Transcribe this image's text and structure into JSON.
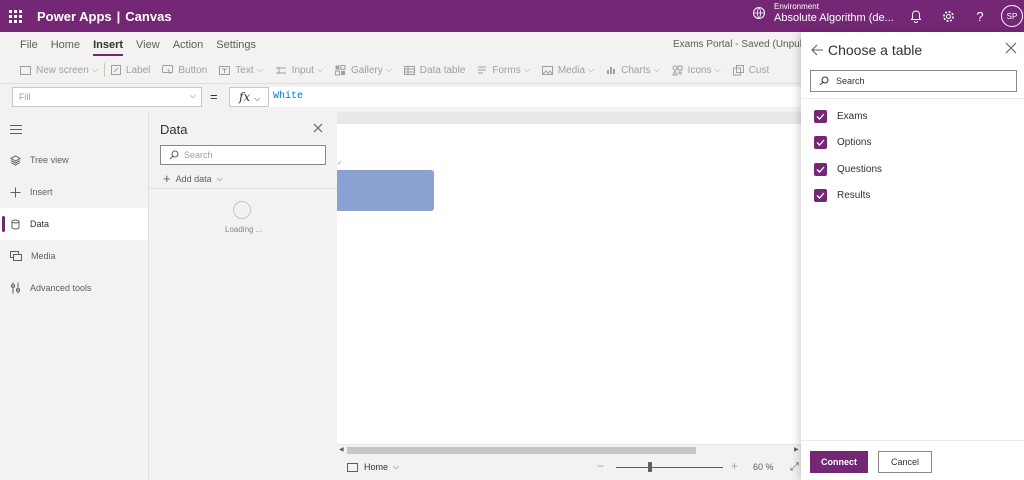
{
  "topbar": {
    "product": "Power Apps",
    "separator": "|",
    "mode": "Canvas",
    "env_label": "Environment",
    "env_name": "Absolute Algorithm (de...",
    "avatar_initials": "SP",
    "help_glyph": "?",
    "brand_color": "#742774"
  },
  "menu": {
    "items": [
      "File",
      "Home",
      "Insert",
      "View",
      "Action",
      "Settings"
    ],
    "active": "Insert",
    "saved_status": "Exams Portal - Saved (Unpublis"
  },
  "toolbar": {
    "items": [
      {
        "label": "New screen",
        "icon": "new-screen-icon"
      },
      {
        "label": "Label",
        "icon": "label-icon"
      },
      {
        "label": "Button",
        "icon": "button-icon"
      },
      {
        "label": "Text",
        "icon": "text-icon"
      },
      {
        "label": "Input",
        "icon": "input-icon"
      },
      {
        "label": "Gallery",
        "icon": "gallery-icon"
      },
      {
        "label": "Data table",
        "icon": "data-table-icon"
      },
      {
        "label": "Forms",
        "icon": "forms-icon"
      },
      {
        "label": "Media",
        "icon": "media-icon"
      },
      {
        "label": "Charts",
        "icon": "charts-icon"
      },
      {
        "label": "Icons",
        "icon": "icons-icon"
      },
      {
        "label": "Cust",
        "icon": "custom-icon"
      }
    ]
  },
  "formula": {
    "property": "Fill",
    "equals": "=",
    "fx": "fx",
    "value": "White"
  },
  "leftnav": {
    "items": [
      {
        "label": "Tree view",
        "icon": "layers-icon"
      },
      {
        "label": "Insert",
        "icon": "plus-icon"
      },
      {
        "label": "Data",
        "icon": "database-icon"
      },
      {
        "label": "Media",
        "icon": "media-icon"
      },
      {
        "label": "Advanced tools",
        "icon": "tools-icon"
      }
    ],
    "active": "Data"
  },
  "data_pane": {
    "title": "Data",
    "search_placeholder": "Search",
    "add_data": "Add data",
    "loading": "Loading ..."
  },
  "canvas": {
    "screen_name": "Home",
    "zoom_value": "60",
    "zoom_unit": "%",
    "zoom_level": 0.3
  },
  "choose_table": {
    "title": "Choose a table",
    "search_placeholder": "Search",
    "tables": [
      {
        "name": "Exams",
        "checked": true
      },
      {
        "name": "Options",
        "checked": true
      },
      {
        "name": "Questions",
        "checked": true
      },
      {
        "name": "Results",
        "checked": true
      }
    ],
    "connect": "Connect",
    "cancel": "Cancel"
  }
}
